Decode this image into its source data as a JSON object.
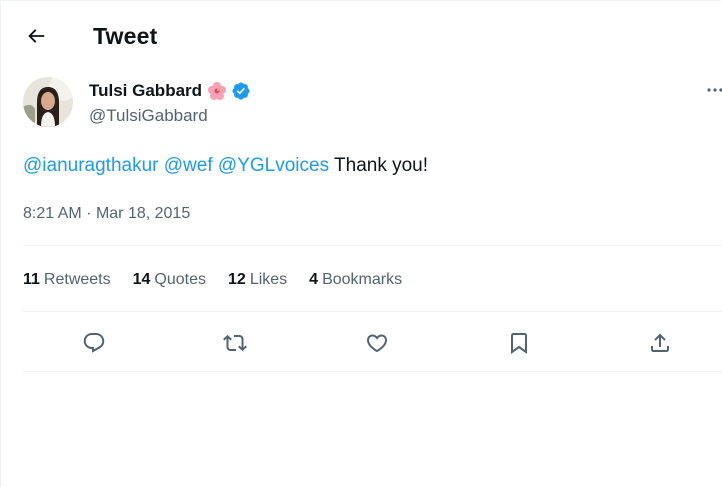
{
  "header": {
    "title": "Tweet",
    "back_icon": "arrow-left-icon"
  },
  "author": {
    "display_name": "Tulsi Gabbard",
    "handle": "@TulsiGabbard",
    "emoji": "hibiscus-flower",
    "verified_icon": "verified-badge-icon",
    "verified_color": "#1d9bf0"
  },
  "tweet": {
    "mentions": [
      "@ianuragthakur",
      "@wef",
      "@YGLvoices"
    ],
    "text": "Thank you!",
    "time": "8:21 AM",
    "separator": "·",
    "date": "Mar 18, 2015"
  },
  "stats": [
    {
      "count": "11",
      "label": "Retweets"
    },
    {
      "count": "14",
      "label": "Quotes"
    },
    {
      "count": "12",
      "label": "Likes"
    },
    {
      "count": "4",
      "label": "Bookmarks"
    }
  ],
  "actions": [
    {
      "name": "reply",
      "icon": "reply-icon"
    },
    {
      "name": "retweet",
      "icon": "retweet-icon"
    },
    {
      "name": "like",
      "icon": "heart-icon"
    },
    {
      "name": "bookmark",
      "icon": "bookmark-icon"
    },
    {
      "name": "share",
      "icon": "share-icon"
    }
  ],
  "colors": {
    "accent": "#1d9bf0",
    "text_primary": "#0f1419",
    "text_secondary": "#536471",
    "divider": "#eff3f4"
  }
}
